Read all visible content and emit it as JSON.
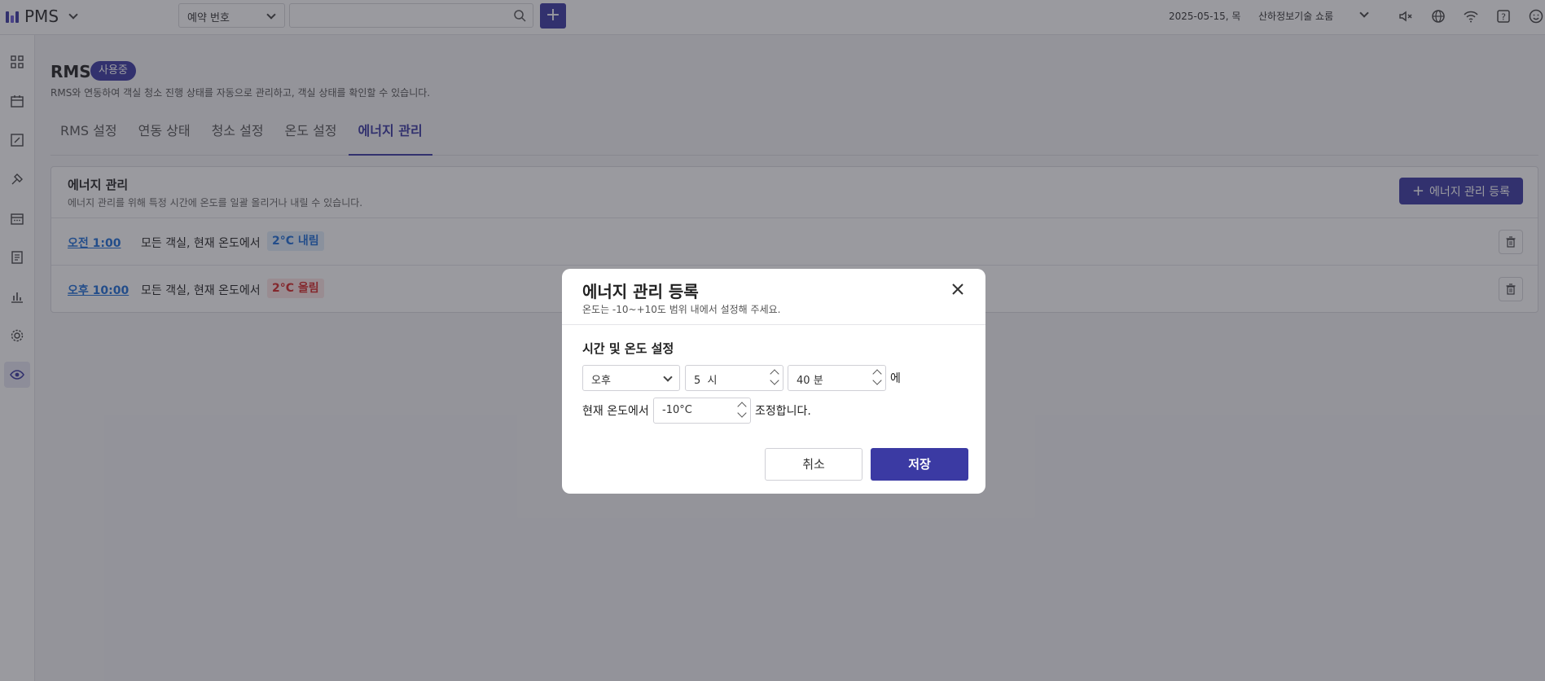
{
  "app": {
    "name": "PMS"
  },
  "topbar": {
    "search_select": "예약 번호",
    "search_placeholder": "",
    "add_label": "+",
    "date": "2025-05-15, 목",
    "store": "산하정보기술 쇼룸",
    "icons": [
      "mute-icon",
      "globe-icon",
      "wifi-icon",
      "help-icon",
      "smile-icon"
    ]
  },
  "sidebar": {
    "icons": [
      "grid-icon",
      "calendar-icon",
      "edit-icon",
      "tools-icon",
      "schedule-icon",
      "document-icon",
      "chart-icon",
      "settings-icon",
      "eye-icon"
    ],
    "active": "eye-icon"
  },
  "page": {
    "title": "RMS",
    "badge": "사용중",
    "description": "RMS와 연동하여 객실 청소 진행 상태를 자동으로 관리하고, 객실 상태를 확인할 수 있습니다."
  },
  "tabs": [
    {
      "label": "RMS 설정",
      "active": false
    },
    {
      "label": "연동 상태",
      "active": false
    },
    {
      "label": "청소 설정",
      "active": false
    },
    {
      "label": "온도 설정",
      "active": false
    },
    {
      "label": "에너지 관리",
      "active": true
    }
  ],
  "panel": {
    "title": "에너지 관리",
    "description": "에너지 관리를 위해 특정 시간에 온도를 일괄 올리거나 내릴 수 있습니다.",
    "register_label": "에너지 관리 등록",
    "rows": [
      {
        "time": "오전 1:00",
        "text": "모든 객실, 현재 온도에서",
        "change": "2°C 내림",
        "direction": "down"
      },
      {
        "time": "오후 10:00",
        "text": "모든 객실, 현재 온도에서",
        "change": "2°C 올림",
        "direction": "up"
      }
    ]
  },
  "modal": {
    "title": "에너지 관리 등록",
    "subtitle": "온도는 -10~+10도 범위 내에서 설정해 주세요.",
    "section_label": "시간 및 온도 설정",
    "ampm_value": "오후",
    "hour_value": "5",
    "hour_unit": "시",
    "minute_value": "40",
    "minute_unit": "분",
    "time_suffix": "에",
    "current_label": "현재 온도에서",
    "temp_value": "-10°C",
    "adjust_label": "조정합니다.",
    "cancel_label": "취소",
    "save_label": "저장"
  },
  "colors": {
    "accent": "#3b3aa3",
    "link": "#1f6fd8",
    "down": "#1f6fd8",
    "up": "#d62828"
  }
}
